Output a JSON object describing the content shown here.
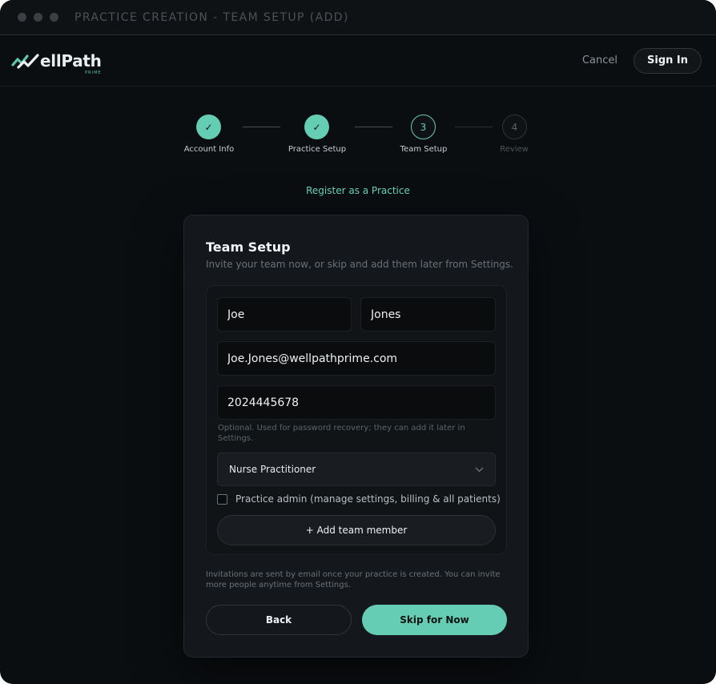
{
  "window": {
    "title": "PRACTICE CREATION - TEAM SETUP (ADD)"
  },
  "brand": {
    "name": "ellPath",
    "sub": "PRIME",
    "accent": "#66cdb5"
  },
  "header": {
    "cancel_label": "Cancel",
    "signin_label": "Sign In"
  },
  "stepper": {
    "steps": [
      {
        "label": "Account Info",
        "state": "done",
        "icon": "check-icon"
      },
      {
        "label": "Practice Setup",
        "state": "done",
        "icon": "check-icon"
      },
      {
        "label": "Team Setup",
        "state": "current",
        "number": "3"
      },
      {
        "label": "Review",
        "state": "todo",
        "number": "4"
      }
    ]
  },
  "register_link": "Register as a Practice",
  "card": {
    "title": "Team Setup",
    "subtitle": "Invite your team now, or skip and add them later from Settings.",
    "member": {
      "first_name": "Joe",
      "last_name": "Jones",
      "email": "Joe.Jones@wellpathprime.com",
      "phone": "2024445678",
      "phone_hint": "Optional. Used for password recovery; they can add it later in Settings.",
      "role": "Nurse Practitioner",
      "admin_label": "Practice admin (manage settings, billing & all patients)"
    },
    "add_member_label": "+ Add team member",
    "note": "Invitations are sent by email once your practice is created. You can invite more people anytime from Settings.",
    "back_label": "Back",
    "skip_label": "Skip for Now"
  }
}
